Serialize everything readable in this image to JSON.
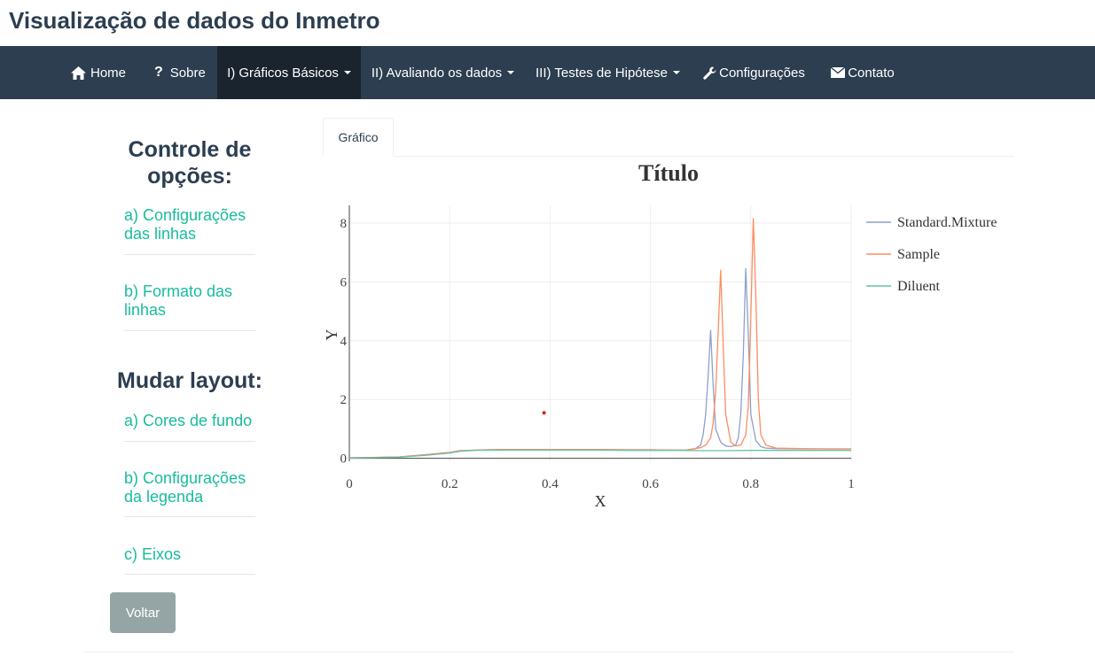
{
  "app": {
    "title": "Visualização de dados do Inmetro"
  },
  "navbar": {
    "items": [
      {
        "label": "Home",
        "icon": "home-icon"
      },
      {
        "label": "Sobre",
        "icon": "question-icon"
      },
      {
        "label": "I) Gráficos Básicos",
        "dropdown": true,
        "active": true
      },
      {
        "label": "II) Avaliando os dados",
        "dropdown": true
      },
      {
        "label": "III) Testes de Hipótese",
        "dropdown": true
      },
      {
        "label": "Configurações",
        "icon": "wrench-icon"
      },
      {
        "label": "Contato",
        "icon": "envelope-icon"
      }
    ]
  },
  "sidebar": {
    "heading1": "Controle de opções:",
    "heading1_line1": "Controle de",
    "heading1_line2": "opções:",
    "group1": [
      {
        "line1": "a) Configurações",
        "line2": "das linhas"
      },
      {
        "line1": "b) Formato das",
        "line2": "linhas"
      }
    ],
    "heading2": "Mudar layout:",
    "group2": [
      {
        "line1": "a) Cores de fundo",
        "line2": ""
      },
      {
        "line1": "b) Configurações",
        "line2": "da legenda"
      },
      {
        "line1": "c) Eixos",
        "line2": ""
      }
    ],
    "back_button": "Voltar"
  },
  "tabs": [
    {
      "label": "Gráfico",
      "active": true
    }
  ],
  "colors": {
    "navbar_bg": "#2c3e50",
    "accent": "#18bc9c",
    "standard_mixture": "#8da0cb",
    "sample": "#fc8d62",
    "diluent": "#66c2a5",
    "marker": "#e31a1c"
  },
  "chart_data": {
    "type": "line",
    "title": "Título",
    "xlabel": "X",
    "ylabel": "Y",
    "xlim": [
      0,
      1
    ],
    "ylim": [
      -0.1,
      8.6
    ],
    "xticks": [
      0,
      0.2,
      0.4,
      0.6,
      0.8,
      1
    ],
    "yticks": [
      0,
      2,
      4,
      6,
      8
    ],
    "xtick_labels": [
      "0",
      "0.2",
      "0.4",
      "0.6",
      "0.8",
      "1"
    ],
    "ytick_labels": [
      "0",
      "2",
      "4",
      "6",
      "8"
    ],
    "grid": true,
    "legend_position": "right",
    "series": [
      {
        "name": "Standard.Mixture",
        "color": "#8da0cb",
        "x": [
          0,
          0.05,
          0.1,
          0.15,
          0.2,
          0.22,
          0.25,
          0.3,
          0.35,
          0.4,
          0.45,
          0.5,
          0.55,
          0.6,
          0.65,
          0.67,
          0.68,
          0.69,
          0.7,
          0.705,
          0.71,
          0.715,
          0.72,
          0.725,
          0.73,
          0.74,
          0.75,
          0.76,
          0.77,
          0.775,
          0.78,
          0.785,
          0.79,
          0.795,
          0.8,
          0.81,
          0.82,
          0.83,
          0.85,
          0.9,
          0.95,
          1
        ],
        "y": [
          0.02,
          0.03,
          0.05,
          0.12,
          0.2,
          0.26,
          0.28,
          0.3,
          0.3,
          0.3,
          0.3,
          0.3,
          0.29,
          0.29,
          0.28,
          0.28,
          0.3,
          0.33,
          0.45,
          0.8,
          1.5,
          2.8,
          4.35,
          2.5,
          1.0,
          0.55,
          0.42,
          0.4,
          0.45,
          0.7,
          1.5,
          3.5,
          6.45,
          4.2,
          1.5,
          0.6,
          0.4,
          0.35,
          0.33,
          0.32,
          0.32,
          0.32
        ]
      },
      {
        "name": "Sample",
        "color": "#fc8d62",
        "x": [
          0,
          0.05,
          0.1,
          0.15,
          0.2,
          0.22,
          0.25,
          0.3,
          0.35,
          0.4,
          0.45,
          0.5,
          0.55,
          0.6,
          0.65,
          0.67,
          0.7,
          0.71,
          0.72,
          0.725,
          0.73,
          0.735,
          0.74,
          0.745,
          0.75,
          0.76,
          0.77,
          0.78,
          0.79,
          0.795,
          0.8,
          0.805,
          0.81,
          0.815,
          0.82,
          0.83,
          0.85,
          0.9,
          0.95,
          1
        ],
        "y": [
          0.02,
          0.03,
          0.05,
          0.12,
          0.2,
          0.26,
          0.28,
          0.3,
          0.3,
          0.3,
          0.3,
          0.3,
          0.29,
          0.29,
          0.28,
          0.28,
          0.36,
          0.45,
          0.7,
          1.2,
          2.3,
          4.3,
          6.4,
          3.8,
          1.5,
          0.55,
          0.42,
          0.45,
          0.8,
          1.8,
          4.8,
          8.15,
          5.5,
          2.0,
          0.8,
          0.45,
          0.35,
          0.33,
          0.32,
          0.32
        ]
      },
      {
        "name": "Diluent",
        "color": "#66c2a5",
        "x": [
          0,
          0.05,
          0.1,
          0.15,
          0.2,
          0.22,
          0.25,
          0.3,
          0.35,
          0.4,
          0.45,
          0.5,
          0.55,
          0.6,
          0.65,
          0.7,
          0.75,
          0.8,
          0.85,
          0.9,
          0.95,
          1
        ],
        "y": [
          0.01,
          0.02,
          0.04,
          0.1,
          0.18,
          0.24,
          0.27,
          0.28,
          0.28,
          0.28,
          0.28,
          0.28,
          0.27,
          0.27,
          0.27,
          0.26,
          0.26,
          0.27,
          0.27,
          0.27,
          0.27,
          0.27
        ]
      }
    ],
    "annotations": [
      {
        "type": "point",
        "x": 0.388,
        "y": 1.55,
        "color": "#e31a1c"
      }
    ]
  }
}
